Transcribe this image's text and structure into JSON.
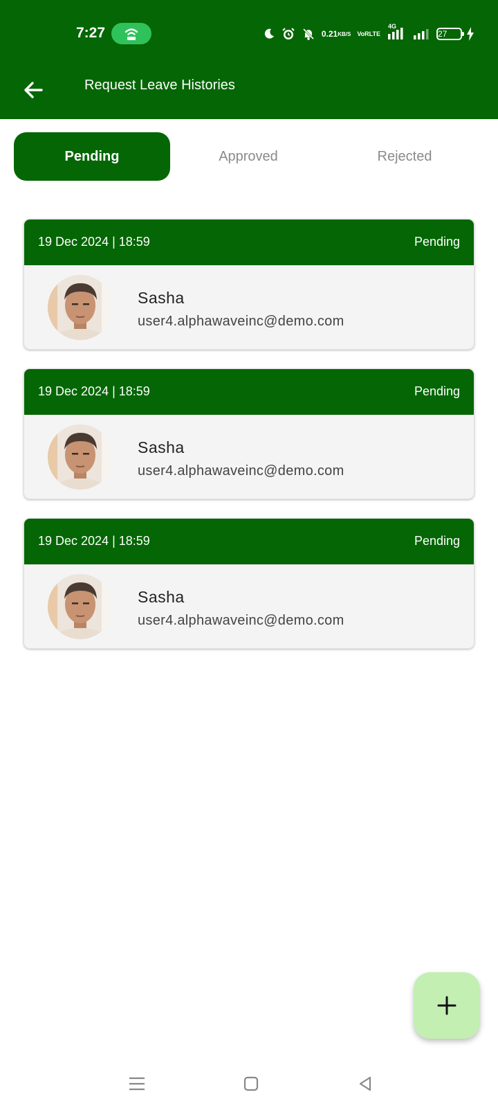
{
  "status_bar": {
    "time": "7:27",
    "net_speed_value": "0.21",
    "net_speed_unit": "KB/S",
    "volte_top": "VoR",
    "volte_bottom": "LTE",
    "network_type": "4G",
    "battery": "27",
    "icons": [
      "hotspot-icon",
      "moon-icon",
      "alarm-icon",
      "bell-muted-icon",
      "signal-icon",
      "signal-icon",
      "charging-icon"
    ]
  },
  "app_bar": {
    "title": "Request Leave Histories",
    "back_icon": "arrow-left-icon"
  },
  "tabs": [
    {
      "label": "Pending",
      "active": true
    },
    {
      "label": "Approved",
      "active": false
    },
    {
      "label": "Rejected",
      "active": false
    }
  ],
  "requests": [
    {
      "date": "19 Dec 2024 | 18:59",
      "status": "Pending",
      "name": "Sasha",
      "email": "user4.alphawaveinc@demo.com"
    },
    {
      "date": "19 Dec 2024 | 18:59",
      "status": "Pending",
      "name": "Sasha",
      "email": "user4.alphawaveinc@demo.com"
    },
    {
      "date": "19 Dec 2024 | 18:59",
      "status": "Pending",
      "name": "Sasha",
      "email": "user4.alphawaveinc@demo.com"
    }
  ],
  "fab": {
    "icon": "plus-icon"
  },
  "nav_bar": {
    "icons": [
      "menu-icon",
      "home-square-icon",
      "back-triangle-icon"
    ]
  },
  "colors": {
    "primary": "#046604",
    "fab": "#c3efb3",
    "card_bg": "#f4f4f4",
    "hotspot": "#2fc25a"
  }
}
